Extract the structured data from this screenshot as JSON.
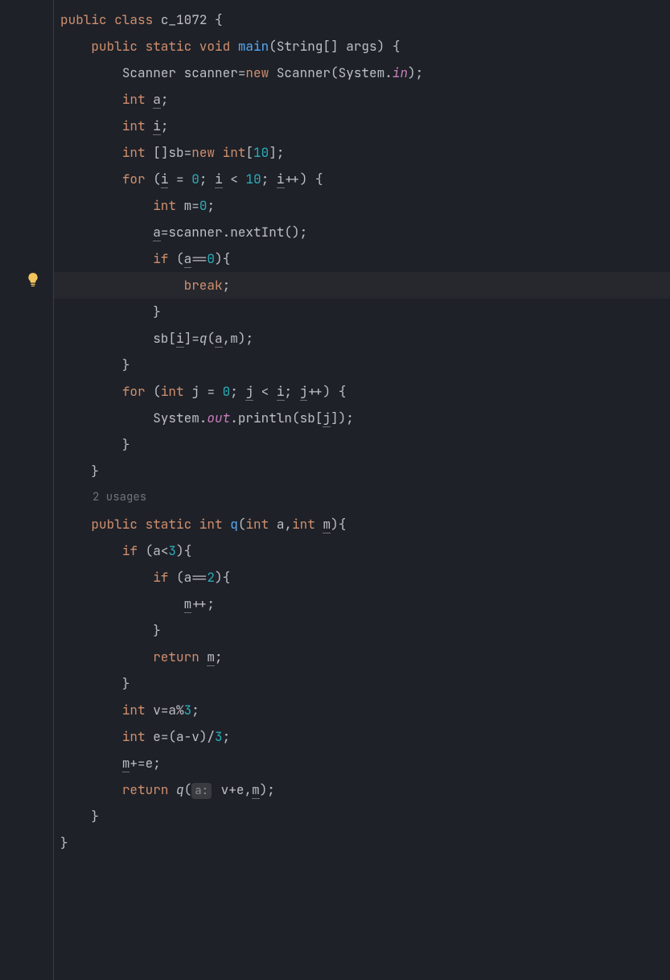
{
  "gutter": {
    "bulb_color": "#F2C55C"
  },
  "hints": {
    "usages": "2 usages",
    "param_a": "a:"
  },
  "code": {
    "l1": {
      "kw1": "public class",
      "cls": "c_1072",
      "p1": " {"
    },
    "l2": {
      "kw1": "public static void",
      "mth": "main",
      "p1": "(String[] args) {"
    },
    "l3": {
      "id": "Scanner scanner=",
      "kw1": "new",
      "p1": " Scanner(System.",
      "fld": "in",
      "p2": ");"
    },
    "l4": {
      "kw1": "int",
      "var": "a",
      "p1": ";"
    },
    "l5": {
      "kw1": "int",
      "var": "i",
      "p1": ";"
    },
    "l6": {
      "kw1": "int",
      "p1": " []sb=",
      "kw2": "new int",
      "p2": "[",
      "num": "10",
      "p3": "];"
    },
    "l7": {
      "kw1": "for",
      "p1": " (",
      "v1": "i",
      "p2": " = ",
      "n1": "0",
      "p3": "; ",
      "v2": "i",
      "p4": " < ",
      "n2": "10",
      "p5": "; ",
      "v3": "i",
      "p6": "++) {"
    },
    "l8": {
      "kw1": "int",
      "p1": " m=",
      "num": "0",
      "p2": ";"
    },
    "l9": {
      "v1": "a",
      "p1": "=scanner.nextInt();"
    },
    "l10": {
      "kw1": "if",
      "p1": " (",
      "v1": "a",
      "p2": "==",
      "num": "0",
      "p3": "){"
    },
    "l11": {
      "kw1": "break",
      "p1": ";"
    },
    "l12": {
      "p1": "}"
    },
    "l13": {
      "p1": "sb[",
      "v1": "i",
      "p2": "]=",
      "fn": "q",
      "p3": "(",
      "v2": "a",
      "p4": ",m);"
    },
    "l14": {
      "p1": "}"
    },
    "l15": {
      "kw1": "for",
      "p1": " (",
      "kw2": "int",
      "p2": " j = ",
      "n1": "0",
      "p3": "; ",
      "v1": "j",
      "p4": " < ",
      "v2": "i",
      "p5": "; ",
      "v3": "j",
      "p6": "++) {"
    },
    "l16": {
      "p1": "System.",
      "fld": "out",
      "p2": ".println(sb[",
      "v1": "j",
      "p3": "]);"
    },
    "l17": {
      "p1": "}"
    },
    "l18": {
      "p1": "}"
    },
    "l19": {
      "kw1": "public static int",
      "mth": "q",
      "p1": "(",
      "kw2": "int",
      "p2": " a,",
      "kw3": "int",
      "p3": " ",
      "v1": "m",
      "p4": "){"
    },
    "l20": {
      "kw1": "if",
      "p1": " (a<",
      "num": "3",
      "p2": "){"
    },
    "l21": {
      "kw1": "if",
      "p1": " (a==",
      "num": "2",
      "p2": "){"
    },
    "l22": {
      "v1": "m",
      "p1": "++;"
    },
    "l23": {
      "p1": "}"
    },
    "l24": {
      "kw1": "return",
      "p1": " ",
      "v1": "m",
      "p2": ";"
    },
    "l25": {
      "p1": "}"
    },
    "l26": {
      "kw1": "int",
      "p1": " v=a%",
      "num": "3",
      "p2": ";"
    },
    "l27": {
      "kw1": "int",
      "p1": " e=(a-v)/",
      "num": "3",
      "p2": ";"
    },
    "l28": {
      "v1": "m",
      "p1": "+=e;"
    },
    "l29": {
      "kw1": "return",
      "p1": " ",
      "fn": "q",
      "p2": "(",
      "p3": " v+e,",
      "v1": "m",
      "p4": ");"
    },
    "l30": {
      "p1": "}"
    },
    "l31": {
      "p1": "}"
    }
  }
}
